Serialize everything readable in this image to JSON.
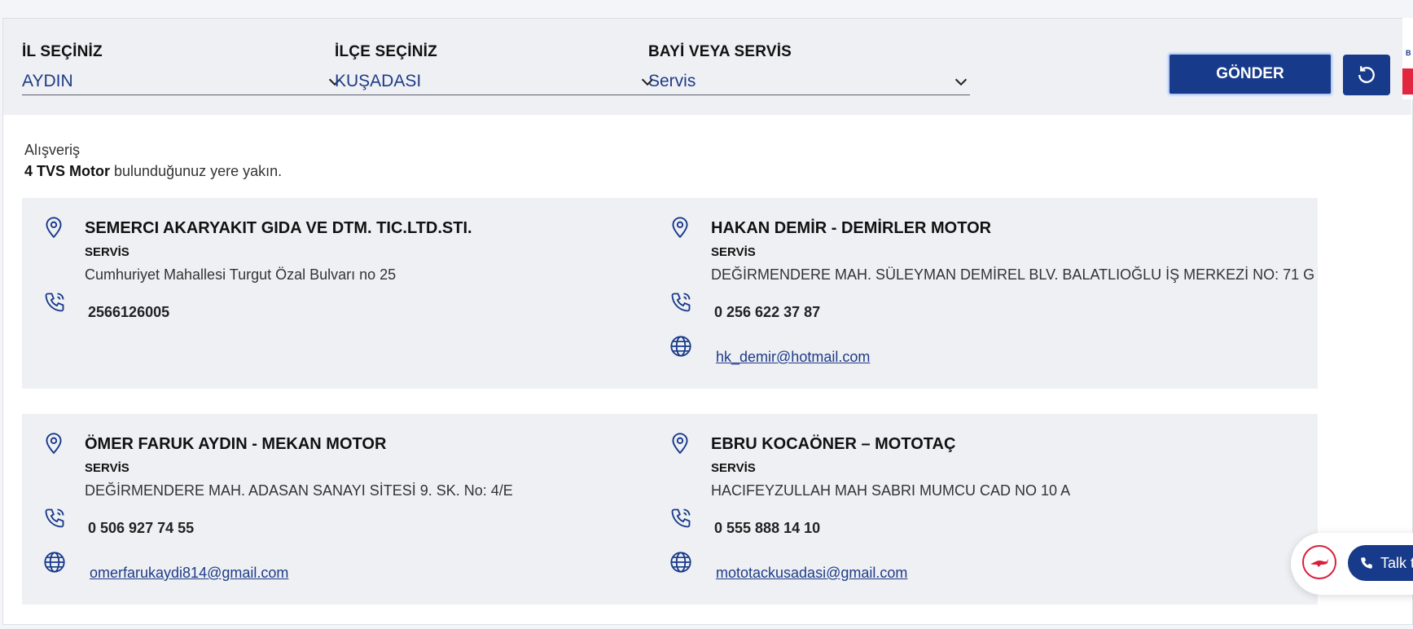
{
  "filters": {
    "province": {
      "label": "İL SEÇİNİZ",
      "value": "AYDIN"
    },
    "district": {
      "label": "İLÇE SEÇİNİZ",
      "value": "KUŞADASI"
    },
    "dealer_type": {
      "label": "BAYİ VEYA SERVİS",
      "value": "Servis"
    },
    "send_label": "GÖNDER"
  },
  "summary": {
    "line1": "Alışveriş",
    "count_brand": "4 TVS Motor",
    "rest": " bulunduğunuz yere yakın."
  },
  "results": [
    {
      "name": "SEMERCI AKARYAKIT GIDA VE DTM. TIC.LTD.STI.",
      "type": "SERVİS",
      "address": "Cumhuriyet Mahallesi Turgut Özal Bulvarı no 25",
      "phone": "2566126005",
      "email": ""
    },
    {
      "name": "HAKAN DEMİR - DEMİRLER MOTOR",
      "type": "SERVİS",
      "address": "DEĞİRMENDERE MAH. SÜLEYMAN DEMİREL BLV. BALATLIOĞLU İŞ MERKEZİ NO: 71 G",
      "phone": "0 256 622 37 87",
      "email": "hk_demir@hotmail.com"
    },
    {
      "name": "ÖMER FARUK AYDIN - MEKAN MOTOR",
      "type": "SERVİS",
      "address": "DEĞİRMENDERE MAH. ADASAN SANAYI SİTESİ 9. SK. No: 4/E",
      "phone": "0 506 927 74 55",
      "email": "omerfarukaydi814@gmail.com"
    },
    {
      "name": "EBRU KOCAÖNER – MOTOTAÇ",
      "type": "SERVİS",
      "address": "HACIFEYZULLAH MAH SABRI MUMCU CAD NO 10 A",
      "phone": "0 555 888 14 10",
      "email": "mototackusadasi@gmail.com"
    }
  ],
  "chat": {
    "label": "Talk t"
  },
  "edge": {
    "text": "B"
  },
  "icons": {
    "location": "location-pin-icon",
    "phone": "phone-icon",
    "web": "globe-icon",
    "reset": "refresh-icon",
    "dropdown": "chevron-down-icon"
  },
  "colors": {
    "brand": "#173a8a",
    "accent_red": "#e3263f",
    "card_bg": "#eff0f4"
  }
}
